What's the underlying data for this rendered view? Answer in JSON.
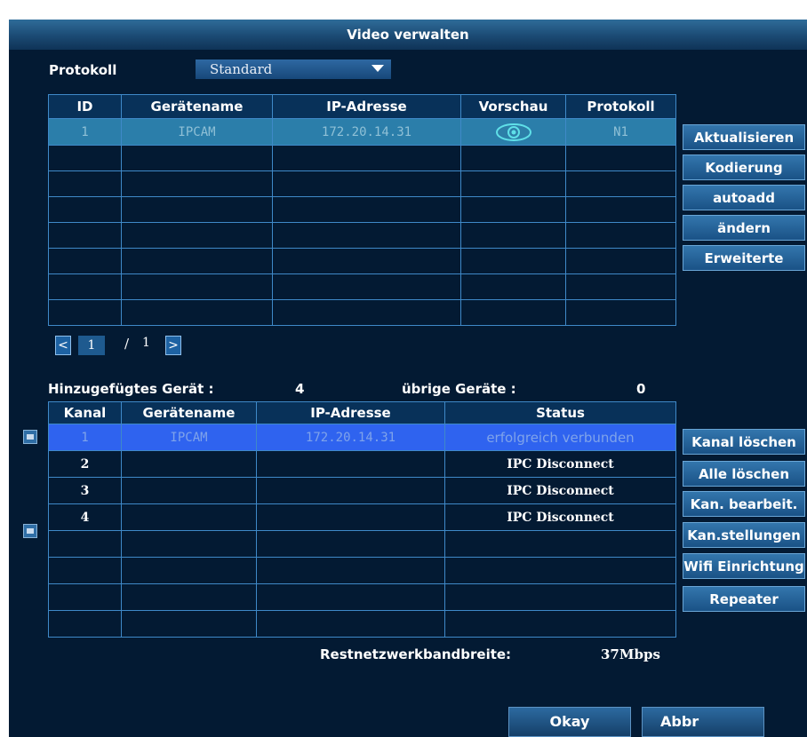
{
  "window": {
    "title": "Video verwalten"
  },
  "protocol": {
    "label": "Protokoll",
    "value": "Standard"
  },
  "search_table": {
    "headers": [
      "ID",
      "Gerätename",
      "IP-Adresse",
      "Vorschau",
      "Protokoll"
    ],
    "rows": [
      [
        "1",
        "IPCAM",
        "172.20.14.31",
        "",
        "N1"
      ]
    ],
    "empty_rows": 7,
    "preview_icon": "eye-icon"
  },
  "right_buttons_top": [
    "Aktualisieren",
    "Kodierung",
    "autoadd",
    "ändern",
    "Erweiterte"
  ],
  "pagination": {
    "prev": "<",
    "current": "1",
    "separator": "/",
    "total": "1",
    "next": ">"
  },
  "summary": {
    "added_label": "Hinzugefügtes Gerät :",
    "added_count": "4",
    "remaining_label": "übrige Geräte :",
    "remaining_count": "0"
  },
  "channel_table": {
    "headers": [
      "Kanal",
      "Gerätename",
      "IP-Adresse",
      "Status"
    ],
    "rows": [
      [
        "1",
        "IPCAM",
        "172.20.14.31",
        "erfolgreich verbunden"
      ],
      [
        "2",
        "",
        "",
        "IPC Disconnect"
      ],
      [
        "3",
        "",
        "",
        "IPC Disconnect"
      ],
      [
        "4",
        "",
        "",
        "IPC Disconnect"
      ]
    ],
    "empty_rows": 4
  },
  "right_buttons_bottom": [
    "Kanal löschen",
    "Alle löschen",
    "Kan. bearbeit.",
    "Kan.stellungen",
    "Wifi Einrichtung",
    "Repeater"
  ],
  "bandwidth": {
    "label": "Restnetzwerkbandbreite:",
    "value": "37Mbps"
  },
  "footer": {
    "ok": "Okay",
    "cancel": "Abbr"
  },
  "colors": {
    "background": "#031a33",
    "title_bar": "#1b4a73",
    "grid_line": "#3f89c8",
    "selected_row_top": "#2b7eaa",
    "selected_row_bottom": "#2f63ef",
    "accent_eye": "#5fe0e8"
  }
}
